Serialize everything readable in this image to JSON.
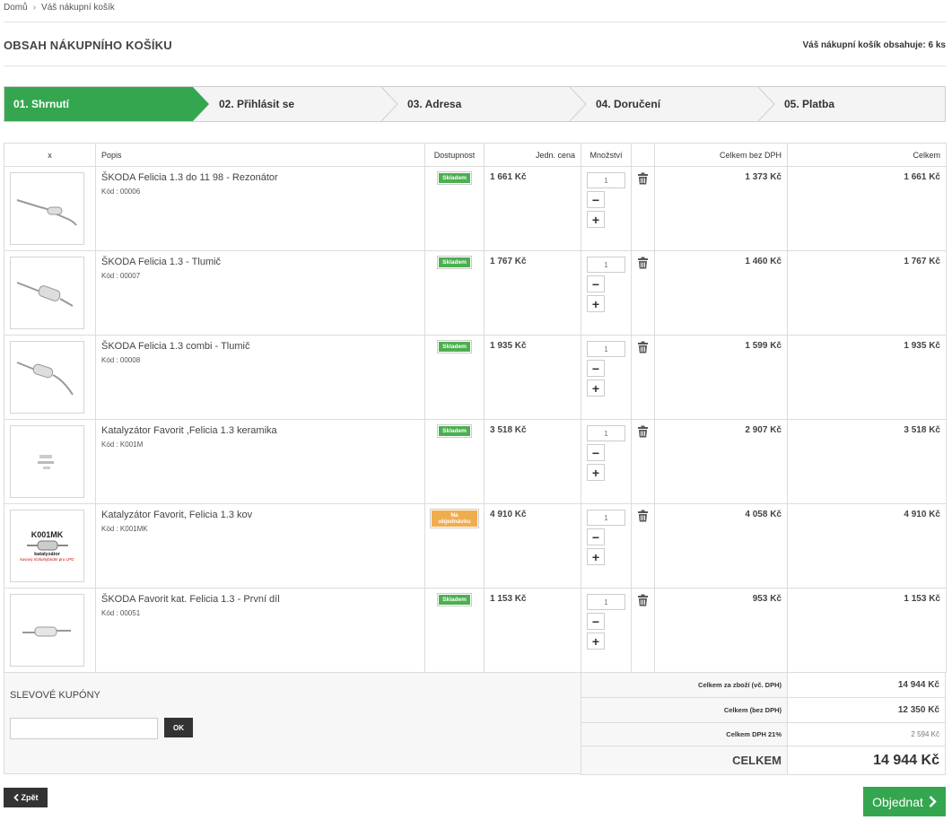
{
  "breadcrumb": {
    "home": "Domů",
    "separator": "›",
    "current": "Váš nákupní košík"
  },
  "header": {
    "title": "OBSAH NÁKUPNÍHO KOŠÍKU",
    "cart_count": "Váš nákupní košík obsahuje: 6 ks"
  },
  "steps": [
    {
      "label": "01. Shrnutí"
    },
    {
      "label": "02. Přihlásit se"
    },
    {
      "label": "03. Adresa"
    },
    {
      "label": "04. Doručení"
    },
    {
      "label": "05. Platba"
    }
  ],
  "columns": {
    "remove": "x",
    "description": "Popis",
    "availability": "Dostupnost",
    "unit_price": "Jedn. cena",
    "quantity": "Množství",
    "total_excl_vat": "Celkem bez DPH",
    "total": "Celkem"
  },
  "items": [
    {
      "name": "ŠKODA Felicia 1.3 do 11 98 - Rezonátor",
      "code": "Kód : 00006",
      "availability": "Skladem",
      "unit_price": "1 661 Kč",
      "qty": "1",
      "total_excl_vat": "1 373 Kč",
      "total": "1 661 Kč"
    },
    {
      "name": "ŠKODA Felicia 1.3 - Tlumič",
      "code": "Kód : 00007",
      "availability": "Skladem",
      "unit_price": "1 767 Kč",
      "qty": "1",
      "total_excl_vat": "1 460 Kč",
      "total": "1 767 Kč"
    },
    {
      "name": "ŠKODA Felicia 1.3 combi - Tlumič",
      "code": "Kód : 00008",
      "availability": "Skladem",
      "unit_price": "1 935 Kč",
      "qty": "1",
      "total_excl_vat": "1 599 Kč",
      "total": "1 935 Kč"
    },
    {
      "name": "Katalyzátor Favorit ,Felicia 1.3 keramika",
      "code": "Kód : K001M",
      "availability": "Skladem",
      "unit_price": "3 518 Kč",
      "qty": "1",
      "total_excl_vat": "2 907 Kč",
      "total": "3 518 Kč"
    },
    {
      "name": "Katalyzátor Favorit, Felicia 1.3 kov",
      "code": "Kód : K001MK",
      "availability": "Na objednávku",
      "unit_price": "4 910 Kč",
      "qty": "1",
      "total_excl_vat": "4 058 Kč",
      "total": "4 910 Kč"
    },
    {
      "name": "ŠKODA Favorit kat. Felicia 1.3 - První díl",
      "code": "Kód : 00051",
      "availability": "Skladem",
      "unit_price": "1 153 Kč",
      "qty": "1",
      "total_excl_vat": "953 Kč",
      "total": "1 153 Kč"
    }
  ],
  "item4_image_text": {
    "line1": "K001MK",
    "line2": "katalyzátor",
    "line3": "kovový nízkohybridní pro LPG"
  },
  "coupons": {
    "title": "SLEVOVÉ KUPÓNY",
    "ok_label": "OK",
    "input_value": ""
  },
  "summary": {
    "goods_incl_vat_label": "Celkem za zboží (vč. DPH)",
    "goods_incl_vat": "14 944 Kč",
    "excl_vat_label": "Celkem (bez DPH)",
    "excl_vat": "12 350 Kč",
    "vat_label": "Celkem DPH 21%",
    "vat": "2 594 Kč",
    "total_label": "CELKEM",
    "total": "14 944 Kč"
  },
  "buttons": {
    "back": "Zpět",
    "order": "Objednat"
  },
  "colors": {
    "accent": "#35a650",
    "in_stock": "#4caf50",
    "on_order": "#f0ad4e",
    "dark_button": "#333333"
  }
}
